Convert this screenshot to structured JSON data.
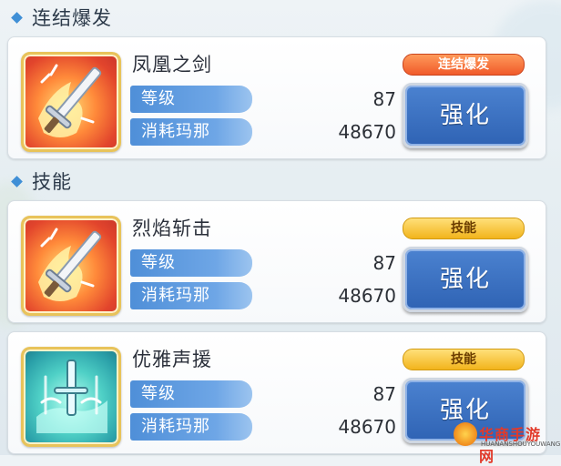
{
  "sections": [
    {
      "title": "连结爆发"
    },
    {
      "title": "技能"
    }
  ],
  "cards": [
    {
      "name": "凤凰之剑",
      "badge": "连结爆发",
      "level_label": "等级",
      "level_value": "87",
      "cost_label": "消耗玛那",
      "cost_value": "48670",
      "button": "强化",
      "icon": "flaming-sword-icon"
    },
    {
      "name": "烈焰斩击",
      "badge": "技能",
      "level_label": "等级",
      "level_value": "87",
      "cost_label": "消耗玛那",
      "cost_value": "48670",
      "button": "强化",
      "icon": "flaming-sword-icon"
    },
    {
      "name": "优雅声援",
      "badge": "技能",
      "level_label": "等级",
      "level_value": "87",
      "cost_label": "消耗玛那",
      "cost_value": "48670",
      "button": "强化",
      "icon": "water-sword-icon"
    }
  ],
  "watermark": {
    "main": "华商手游网",
    "sub": "HUANANSHOUYOUWANG"
  },
  "colors": {
    "accent_blue": "#3f8fd6",
    "button_blue": "#2f63b4",
    "badge_orange": "#f05a2a",
    "badge_yellow": "#f2b41c"
  }
}
